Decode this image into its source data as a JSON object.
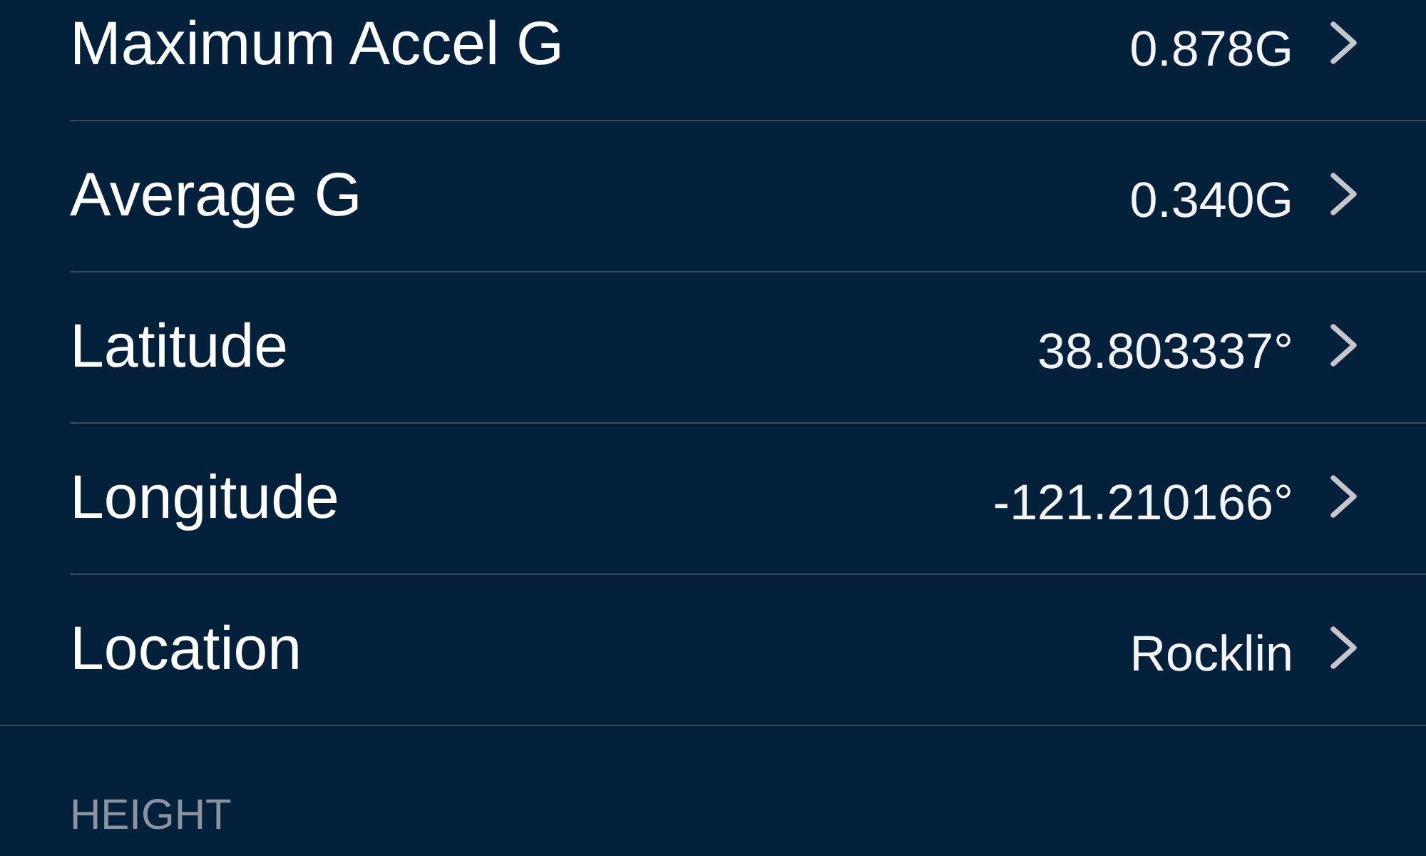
{
  "rows": [
    {
      "label": "Maximum Accel G",
      "value": "0.878G"
    },
    {
      "label": "Average G",
      "value": "0.340G"
    },
    {
      "label": "Latitude",
      "value": "38.803337°"
    },
    {
      "label": "Longitude",
      "value": "-121.210166°"
    },
    {
      "label": "Location",
      "value": "Rocklin"
    }
  ],
  "section_header": "HEIGHT"
}
